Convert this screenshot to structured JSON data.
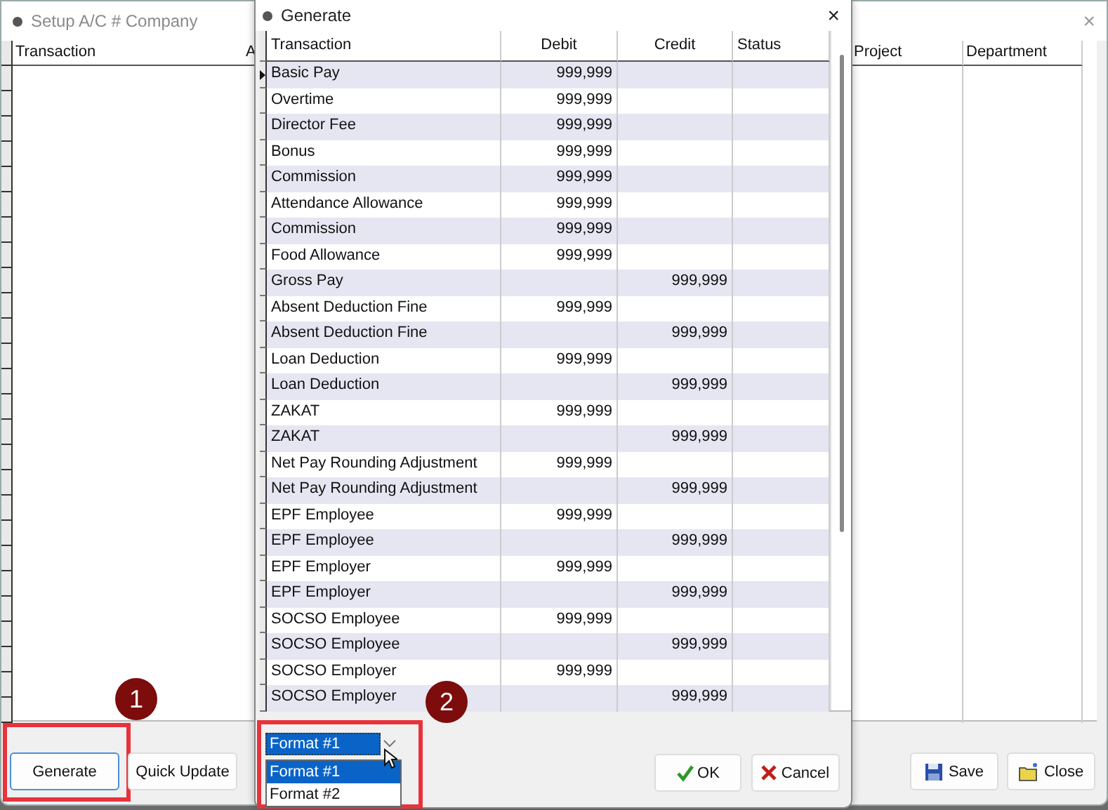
{
  "background_window": {
    "title": "Setup A/C # Company",
    "close_glyph": "×",
    "columns": [
      "Transaction",
      "A",
      "Project",
      "Department"
    ],
    "buttons": [
      {
        "label": "Generate",
        "kind": "plain",
        "focused": true
      },
      {
        "label": "Quick Update",
        "kind": "plain",
        "focused": false
      },
      {
        "label": "Save",
        "kind": "save",
        "focused": false
      },
      {
        "label": "Close",
        "kind": "close",
        "focused": false
      }
    ]
  },
  "dialog": {
    "title": "Generate",
    "close_glyph": "×",
    "columns": [
      "Transaction",
      "Debit",
      "Credit",
      "Status"
    ],
    "rows": [
      {
        "transaction": "Basic Pay",
        "debit": "999,999",
        "selected": true
      },
      {
        "transaction": "Overtime",
        "debit": "999,999",
        "selected": false
      },
      {
        "transaction": "Director Fee",
        "debit": "999,999",
        "selected": false
      },
      {
        "transaction": "Bonus",
        "debit": "999,999",
        "selected": false
      },
      {
        "transaction": "Commission",
        "debit": "999,999",
        "selected": false
      },
      {
        "transaction": "Attendance Allowance",
        "debit": "999,999",
        "selected": false
      },
      {
        "transaction": "Commission",
        "debit": "999,999",
        "selected": false
      },
      {
        "transaction": "Food Allowance",
        "debit": "999,999",
        "selected": false
      },
      {
        "transaction": "Gross Pay",
        "credit": "999,999",
        "selected": false
      },
      {
        "transaction": "Absent Deduction Fine",
        "debit": "999,999",
        "selected": false
      },
      {
        "transaction": "Absent Deduction Fine",
        "credit": "999,999",
        "selected": false
      },
      {
        "transaction": "Loan Deduction",
        "debit": "999,999",
        "selected": false
      },
      {
        "transaction": "Loan Deduction",
        "credit": "999,999",
        "selected": false
      },
      {
        "transaction": "ZAKAT",
        "debit": "999,999",
        "selected": false
      },
      {
        "transaction": "ZAKAT",
        "credit": "999,999",
        "selected": false
      },
      {
        "transaction": "Net Pay Rounding Adjustment",
        "debit": "999,999",
        "selected": false
      },
      {
        "transaction": "Net Pay Rounding Adjustment",
        "credit": "999,999",
        "selected": false
      },
      {
        "transaction": "EPF Employee",
        "debit": "999,999",
        "selected": false
      },
      {
        "transaction": "EPF Employee",
        "credit": "999,999",
        "selected": false
      },
      {
        "transaction": "EPF Employer",
        "debit": "999,999",
        "selected": false
      },
      {
        "transaction": "EPF Employer",
        "credit": "999,999",
        "selected": false
      },
      {
        "transaction": "SOCSO Employee",
        "debit": "999,999",
        "selected": false
      },
      {
        "transaction": "SOCSO Employee",
        "credit": "999,999",
        "selected": false
      },
      {
        "transaction": "SOCSO Employer",
        "debit": "999,999",
        "selected": false
      },
      {
        "transaction": "SOCSO Employer",
        "credit": "999,999",
        "selected": false
      }
    ],
    "format": {
      "value": "Format #1",
      "options": [
        {
          "label": "Format #1",
          "selected": true
        },
        {
          "label": "Format #2",
          "selected": false
        }
      ]
    },
    "buttons": [
      {
        "label": "OK",
        "kind": "ok"
      },
      {
        "label": "Cancel",
        "kind": "cancel"
      }
    ]
  },
  "annotations": [
    {
      "number": "1"
    },
    {
      "number": "2"
    }
  ]
}
